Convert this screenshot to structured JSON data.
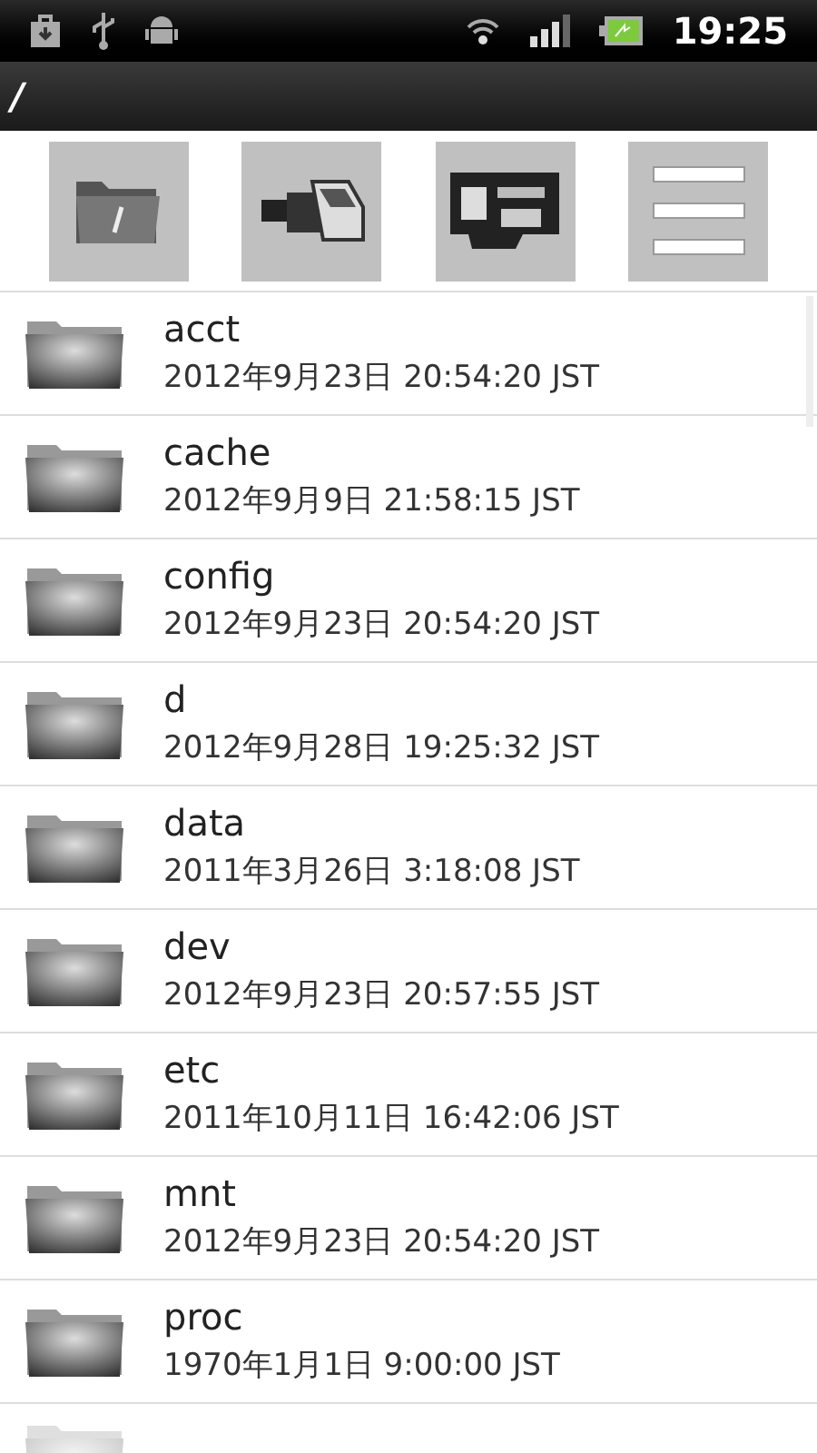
{
  "status_bar": {
    "time": "19:25"
  },
  "title_bar": {
    "path": "/"
  },
  "toolbar": [
    {
      "kind": "root"
    },
    {
      "kind": "usb"
    },
    {
      "kind": "sd"
    },
    {
      "kind": "menu"
    }
  ],
  "files": [
    {
      "name": "acct",
      "modified": "2012年9月23日 20:54:20 JST"
    },
    {
      "name": "cache",
      "modified": "2012年9月9日 21:58:15 JST"
    },
    {
      "name": "config",
      "modified": "2012年9月23日 20:54:20 JST"
    },
    {
      "name": "d",
      "modified": "2012年9月28日 19:25:32 JST"
    },
    {
      "name": "data",
      "modified": "2011年3月26日 3:18:08 JST"
    },
    {
      "name": "dev",
      "modified": "2012年9月23日 20:57:55 JST"
    },
    {
      "name": "etc",
      "modified": "2011年10月11日 16:42:06 JST"
    },
    {
      "name": "mnt",
      "modified": "2012年9月23日 20:54:20 JST"
    },
    {
      "name": "proc",
      "modified": "1970年1月1日 9:00:00 JST"
    }
  ]
}
